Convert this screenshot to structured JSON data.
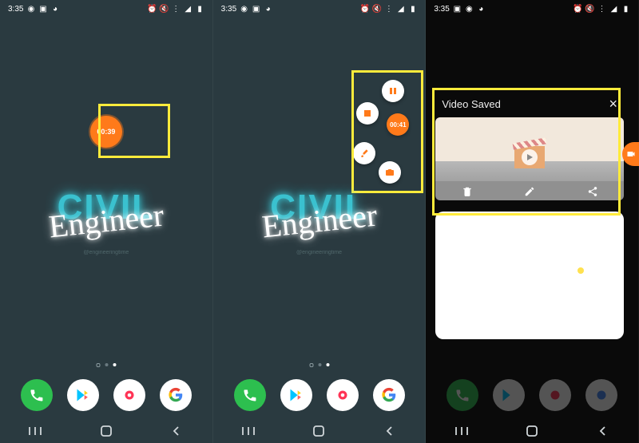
{
  "statusbar": {
    "time": "3:35",
    "left_icons": [
      "screenrec",
      "image",
      "messenger"
    ],
    "right_icons": [
      "alarm",
      "mute",
      "wifi",
      "signal",
      "battery"
    ]
  },
  "wallpaper": {
    "civil": "CIVIL",
    "engineer": "Engineer",
    "handle": "@engineeringtime"
  },
  "record": {
    "panel1_time": "00:39",
    "panel2_time": "00:41"
  },
  "radial": {
    "pause_label": "pause",
    "stop_label": "stop",
    "brush_label": "brush",
    "camera_label": "camera"
  },
  "video_saved": {
    "title": "Video Saved",
    "close": "×",
    "actions": {
      "delete": "delete",
      "edit": "edit",
      "share": "share"
    }
  },
  "dock": {
    "phone": "phone",
    "playstore": "playstore",
    "camera": "camera",
    "google": "google"
  },
  "nav": {
    "recents": "recents",
    "home": "home",
    "back": "back"
  }
}
